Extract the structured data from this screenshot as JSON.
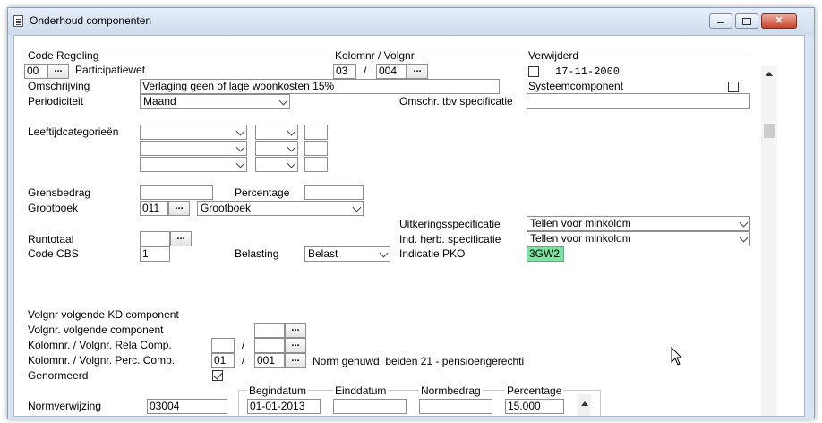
{
  "window": {
    "title": "Onderhoud componenten"
  },
  "header": {
    "code_regeling_label": "Code Regeling",
    "code_regeling_code": "00",
    "code_regeling_name": "Participatiewet",
    "kolomnr_label": "Kolomnr / Volgnr",
    "kolomnr": "03",
    "separator": "/",
    "volgnr": "004",
    "verwijderd_label": "Verwijderd",
    "verwijderd_date": "17-11-2000",
    "verwijderd_checked": false,
    "omschrijving_label": "Omschrijving",
    "omschrijving_value": "Verlaging geen of lage woonkosten 15%",
    "systeemcomponent_label": "Systeemcomponent",
    "systeemcomponent_checked": false,
    "periodiciteit_label": "Periodiciteit",
    "periodiciteit_value": "Maand",
    "omschr_spec_label": "Omschr. tbv specificatie",
    "omschr_spec_value": ""
  },
  "leeftijd": {
    "label": "Leeftijdcategorieën"
  },
  "financieel": {
    "grensbedrag_label": "Grensbedrag",
    "grensbedrag_value": "",
    "percentage_label": "Percentage",
    "percentage_value": "",
    "grootboek_label": "Grootboek",
    "grootboek_code": "011",
    "grootboek_value": "Grootboek",
    "uitkeringsspec_label": "Uitkeringsspecificatie",
    "uitkeringsspec_value": "Tellen voor minkolom",
    "ind_herb_label": "Ind. herb. specificatie",
    "ind_herb_value": "Tellen voor minkolom",
    "runtotaal_label": "Runtotaal",
    "runtotaal_value": "",
    "code_cbs_label": "Code CBS",
    "code_cbs_value": "1",
    "belasting_label": "Belasting",
    "belasting_value": "Belast",
    "indicatie_pko_label": "Indicatie PKO",
    "indicatie_pko_value": "3GW2"
  },
  "volgorde": {
    "volgnr_kd_label": "Volgnr volgende KD component",
    "volgnr_volgende_label": "Volgnr. volgende component",
    "rela_label": "Kolomnr. / Volgnr. Rela Comp.",
    "perc_label": "Kolomnr. / Volgnr. Perc. Comp.",
    "perc_kolom": "01",
    "perc_volg": "001",
    "perc_desc": "Norm gehuwd.  beiden 21 - pensioengerechti",
    "genormeerd_label": "Genormeerd",
    "genormeerd_checked": true,
    "separator": "/"
  },
  "norm": {
    "normverwijzing_label": "Normverwijzing",
    "normverwijzing_value": "03004",
    "columns": [
      "Begindatum",
      "Einddatum",
      "Normbedrag",
      "Percentage"
    ],
    "rows": [
      {
        "begindatum": "01-01-2013",
        "einddatum": "",
        "normbedrag": "",
        "percentage": "15.000"
      }
    ]
  },
  "icons": {
    "dots": "...",
    "minimize": "▭",
    "maximize": "□",
    "close": "✕"
  }
}
